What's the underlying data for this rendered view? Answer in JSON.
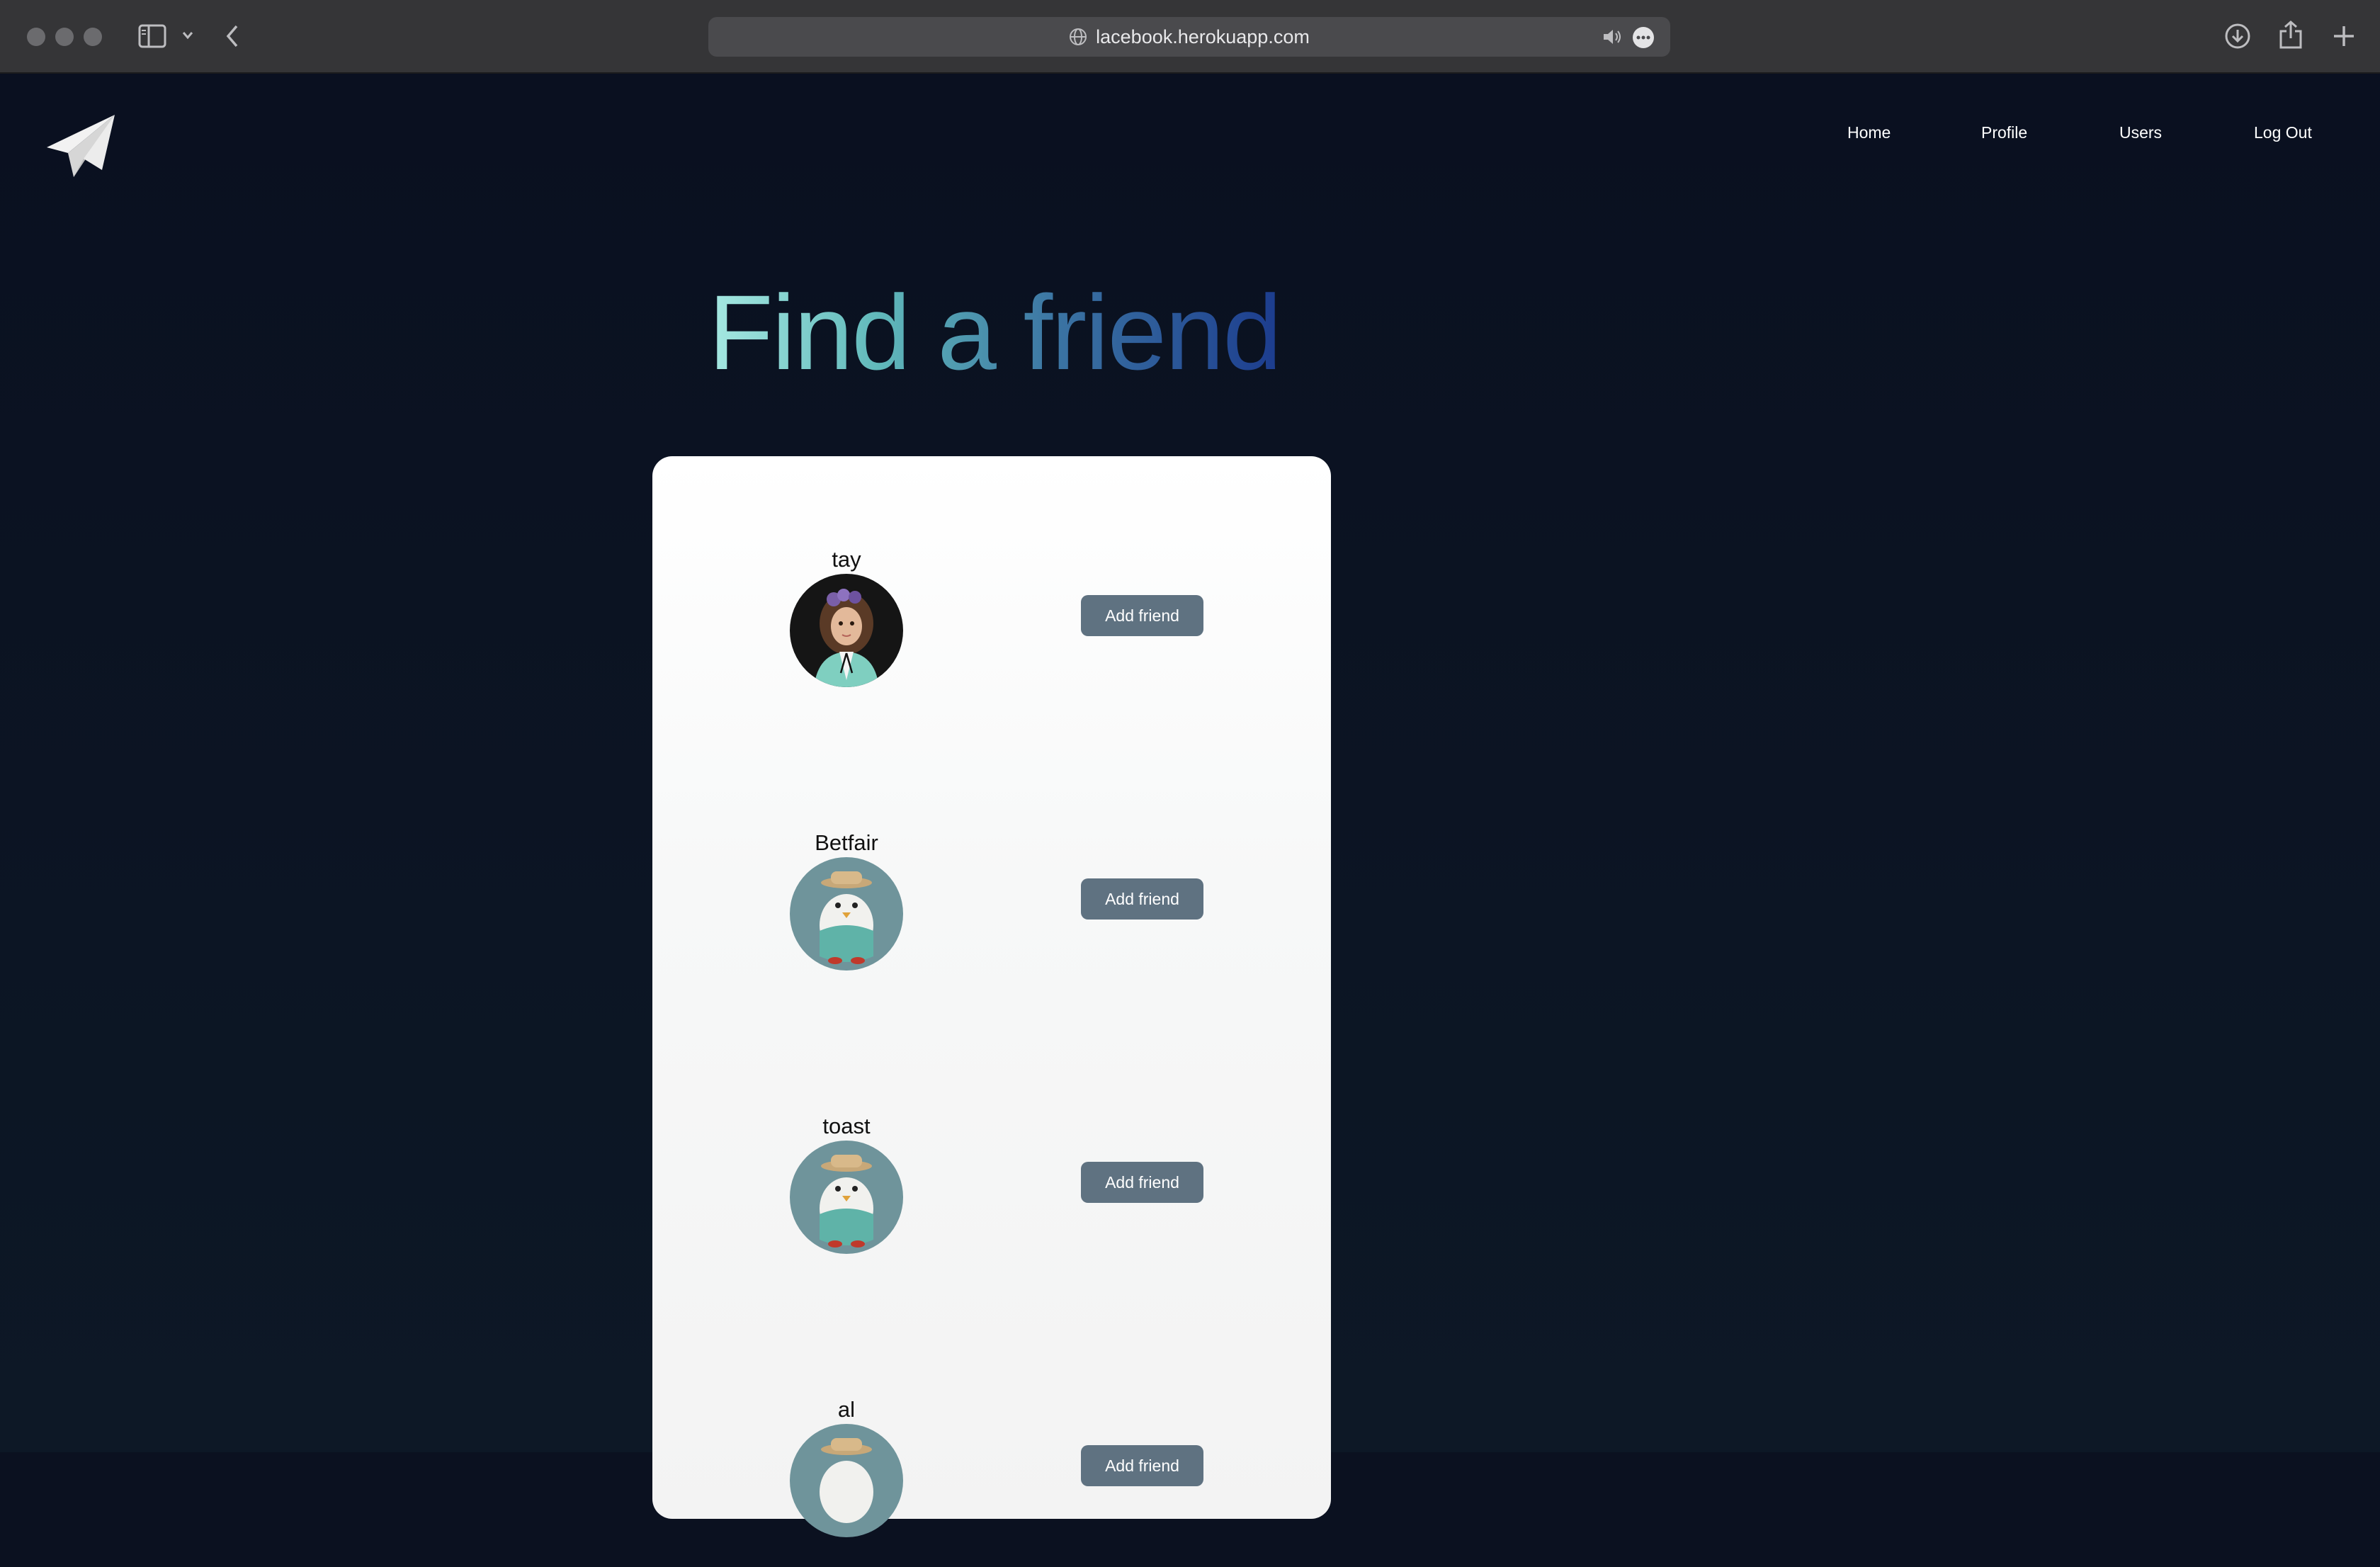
{
  "browser": {
    "url": "lacebook.herokuapp.com"
  },
  "nav": {
    "links": [
      "Home",
      "Profile",
      "Users",
      "Log Out"
    ]
  },
  "page": {
    "title": "Find a friend"
  },
  "users": [
    {
      "name": "tay",
      "button": "Add friend",
      "avatar": "girl-avatar"
    },
    {
      "name": "Betfair",
      "button": "Add friend",
      "avatar": "default-bird-avatar"
    },
    {
      "name": "toast",
      "button": "Add friend",
      "avatar": "default-bird-avatar"
    },
    {
      "name": "al",
      "button": "Add friend",
      "avatar": "default-bird-avatar"
    }
  ],
  "colors": {
    "page_bg": "#0b1120",
    "button_bg": "#5f7281",
    "heading_gradient_start": "#a6e9e2",
    "heading_gradient_end": "#1c3c8e"
  }
}
